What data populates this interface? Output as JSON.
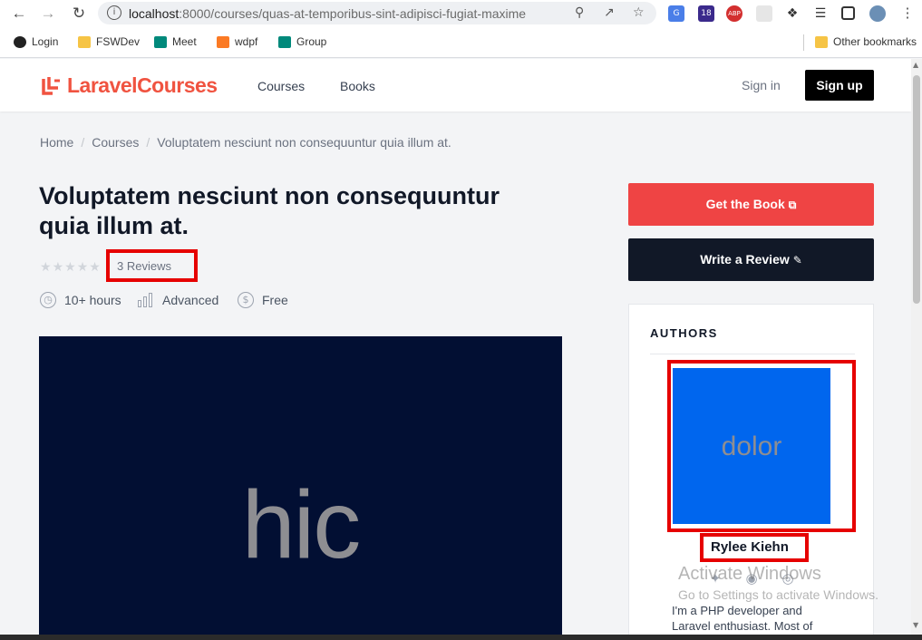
{
  "browser": {
    "url_host": "localhost",
    "url_rest": ":8000/courses/quas-at-temporibus-sint-adipisci-fugiat-maxime",
    "extension_badge": "18",
    "abp_label": "ABP",
    "bookmarks": [
      {
        "label": "Login",
        "icon": "github-icon"
      },
      {
        "label": "FSWDev",
        "icon": "folder-icon"
      },
      {
        "label": "Meet",
        "icon": "meet-icon"
      },
      {
        "label": "wdpf",
        "icon": "xampp-icon"
      },
      {
        "label": "Group",
        "icon": "meet-icon"
      }
    ],
    "other_bookmarks": "Other bookmarks"
  },
  "header": {
    "logo_part1": "Laravel",
    "logo_part2": "Courses",
    "nav": [
      "Courses",
      "Books"
    ],
    "signin": "Sign in",
    "signup": "Sign up"
  },
  "breadcrumb": [
    "Home",
    "Courses",
    "Voluptatem nesciunt non consequuntur quia illum at."
  ],
  "course": {
    "title": "Voluptatem nesciunt non consequuntur quia illum at.",
    "rating": 0,
    "reviews": "3 Reviews",
    "duration": "10+ hours",
    "level": "Advanced",
    "price": "Free",
    "cover_text": "hic"
  },
  "actions": {
    "get_book": "Get the Book",
    "write_review": "Write a Review"
  },
  "authors": {
    "heading": "AUTHORS",
    "avatar_text": "dolor",
    "name": "Rylee Kiehn",
    "bio": "I'm a PHP developer and Laravel enthusiast. Most of"
  },
  "watermark": {
    "title": "Activate Windows",
    "subtitle": "Go to Settings to activate Windows."
  },
  "colors": {
    "brand": "#f05340",
    "primary_button": "#ef4444",
    "dark_button": "#111827",
    "highlight_box": "#e60000"
  }
}
